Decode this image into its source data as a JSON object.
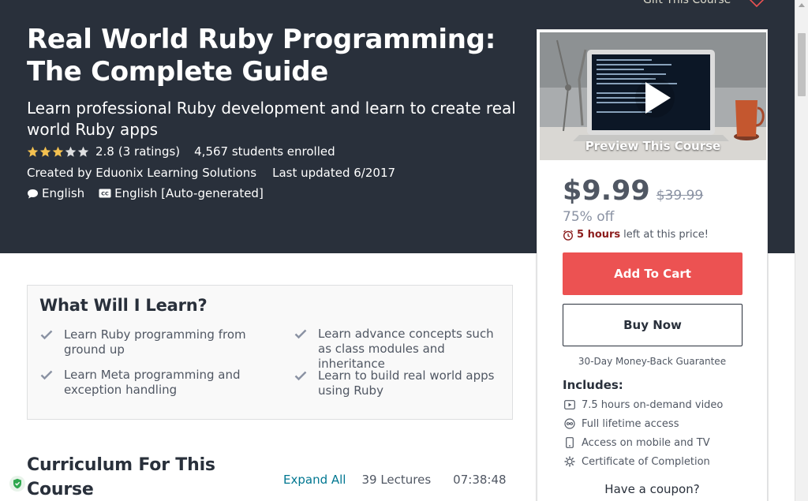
{
  "header": {
    "gift_label": "Gift This Course",
    "title": "Real World Ruby Programming: The Complete Guide",
    "subtitle": "Learn professional Ruby development and learn to create real world Ruby apps",
    "rating": {
      "stars": 2.8,
      "rating_value": "2.8",
      "ratings_text": "(3 ratings)",
      "enrolled_text": "4,567 students enrolled"
    },
    "created_by": "Created by Eduonix Learning Solutions",
    "last_updated": "Last updated 6/2017",
    "language": "English",
    "captions": "English [Auto-generated]"
  },
  "sidebar": {
    "preview_label": "Preview This Course",
    "price": "$9.99",
    "original_price": "$39.99",
    "discount": "75% off",
    "timer_strong": "5 hours",
    "timer_rest": "left at this price!",
    "add_to_cart": "Add To Cart",
    "buy_now": "Buy Now",
    "guarantee": "30-Day Money-Back Guarantee",
    "includes_title": "Includes:",
    "includes": [
      {
        "icon": "video-icon",
        "label": "7.5 hours on-demand video"
      },
      {
        "icon": "infinity-icon",
        "label": "Full lifetime access"
      },
      {
        "icon": "mobile-icon",
        "label": "Access on mobile and TV"
      },
      {
        "icon": "certificate-icon",
        "label": "Certificate of Completion"
      }
    ],
    "coupon": "Have a coupon?"
  },
  "learn": {
    "title": "What Will I Learn?",
    "items": [
      "Learn Ruby programming from ground up",
      "Learn advance concepts such as class modules and inheritance",
      "Learn Meta programming and exception handling",
      "Learn to build real world apps using Ruby"
    ]
  },
  "curriculum": {
    "title": "Curriculum For This Course",
    "expand_label": "Expand All",
    "lectures": "39 Lectures",
    "duration": "07:38:48"
  },
  "colors": {
    "hero_bg": "#29303b",
    "cart_button": "#ec5252",
    "link": "#007791",
    "star": "#f4c150",
    "timer_accent": "#8c1d1d"
  }
}
